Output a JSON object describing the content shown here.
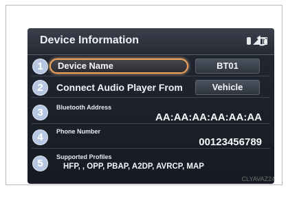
{
  "screen": {
    "title": "Device Information",
    "status_icons": [
      "bluetooth-icon",
      "signal-icon",
      "battery-icon"
    ],
    "back_icon": "back-arrow-icon"
  },
  "rows": [
    {
      "number": "1",
      "label": "Device Name",
      "value": "BT01"
    },
    {
      "number": "2",
      "label": "Connect Audio Player From",
      "value": "Vehicle"
    },
    {
      "number": "3",
      "label": "Bluetooth Address",
      "value": "AA:AA:AA:AA:AA:AA"
    },
    {
      "number": "4",
      "label": "Phone Number",
      "value": "00123456789"
    },
    {
      "number": "5",
      "label": "Supported Profiles",
      "value": "HFP,      , OPP, PBAP, A2DP, AVRCP, MAP"
    }
  ],
  "caption": "CLYAVAZ24",
  "colors": {
    "screen_bg": "#1b1f28",
    "badge": "#b7c7e1",
    "focus_outline": "#f0a15a"
  }
}
